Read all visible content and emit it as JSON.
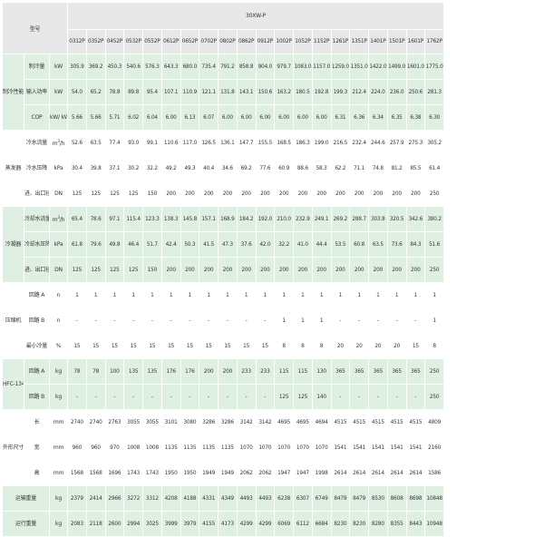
{
  "header": {
    "type_label": "型号",
    "series": "30XW-P",
    "models": [
      "0312P",
      "0352P",
      "0452P",
      "0532P",
      "0552P",
      "0612P",
      "0652P",
      "0702P",
      "0802P",
      "0862P",
      "0912P",
      "1002P",
      "1052P",
      "1152P",
      "1261P",
      "1351P",
      "1401P",
      "1501P",
      "1601P",
      "1762P"
    ]
  },
  "groups": [
    {
      "label": "制冷性能",
      "color": "green",
      "rows": [
        {
          "name": "制冷量",
          "unit": "kW",
          "values": [
            "305.9",
            "369.2",
            "450.3",
            "540.6",
            "576.3",
            "643.3",
            "680.0",
            "735.4",
            "791.2",
            "858.8",
            "904.0",
            "979.7",
            "1083.0",
            "1157.0",
            "1259.0",
            "1351.0",
            "1422.0",
            "1499.0",
            "1601.0",
            "1775.0"
          ]
        },
        {
          "name": "输入功率",
          "unit": "kW",
          "values": [
            "54.0",
            "65.2",
            "78.8",
            "89.8",
            "95.4",
            "107.1",
            "110.9",
            "121.1",
            "131.8",
            "143.1",
            "150.6",
            "163.2",
            "180.5",
            "192.8",
            "199.3",
            "212.4",
            "224.0",
            "236.0",
            "250.6",
            "281.3"
          ]
        },
        {
          "name": "COP",
          "unit": "kW/ kW",
          "values": [
            "5.66",
            "5.66",
            "5.71",
            "6.02",
            "6.04",
            "6.00",
            "6.13",
            "6.07",
            "6.00",
            "6.00",
            "6.00",
            "6.00",
            "6.00",
            "6.00",
            "6.31",
            "6.36",
            "6.34",
            "6.35",
            "6.38",
            "6.30"
          ]
        }
      ]
    },
    {
      "label": "蒸发器",
      "color": "white",
      "rows": [
        {
          "name": "冷水流量",
          "unit": "m³/h",
          "values": [
            "52.6",
            "63.5",
            "77.4",
            "93.0",
            "99.1",
            "110.6",
            "117.0",
            "126.5",
            "136.1",
            "147.7",
            "155.5",
            "168.5",
            "186.3",
            "199.0",
            "216.5",
            "232.4",
            "244.6",
            "257.9",
            "275.3",
            "305.2"
          ]
        },
        {
          "name": "冷水压降",
          "unit": "kPa",
          "values": [
            "30.4",
            "39.8",
            "37.1",
            "30.2",
            "32.2",
            "49.2",
            "49.3",
            "40.4",
            "34.6",
            "69.2",
            "77.6",
            "60.9",
            "88.6",
            "58.3",
            "62.2",
            "71.1",
            "74.8",
            "81.2",
            "85.5",
            "61.4"
          ]
        },
        {
          "name": "进、出口径",
          "unit": "DN",
          "values": [
            "125",
            "125",
            "125",
            "125",
            "150",
            "200",
            "200",
            "200",
            "200",
            "200",
            "200",
            "200",
            "200",
            "200",
            "200",
            "200",
            "200",
            "200",
            "200",
            "250"
          ]
        }
      ]
    },
    {
      "label": "冷凝器",
      "color": "green",
      "rows": [
        {
          "name": "冷却水流量",
          "unit": "m³/h",
          "values": [
            "65.4",
            "78.6",
            "97.1",
            "115.4",
            "123.3",
            "138.3",
            "145.8",
            "157.1",
            "168.9",
            "184.2",
            "192.0",
            "210.0",
            "232.9",
            "249.1",
            "269.2",
            "288.7",
            "303.8",
            "320.5",
            "342.6",
            "380.2"
          ]
        },
        {
          "name": "冷却水压降",
          "unit": "kPa",
          "values": [
            "61.8",
            "79.6",
            "49.8",
            "46.4",
            "51.7",
            "42.4",
            "50.3",
            "41.5",
            "47.3",
            "37.6",
            "42.0",
            "32.2",
            "41.0",
            "44.4",
            "53.5",
            "60.8",
            "63.5",
            "73.6",
            "84.3",
            "51.6"
          ]
        },
        {
          "name": "进、出口径",
          "unit": "DN",
          "values": [
            "125",
            "125",
            "125",
            "125",
            "150",
            "200",
            "200",
            "200",
            "200",
            "200",
            "200",
            "200",
            "200",
            "200",
            "200",
            "200",
            "200",
            "200",
            "200",
            "250"
          ]
        }
      ]
    },
    {
      "label": "压缩机",
      "color": "white",
      "rows": [
        {
          "name": "回路 A",
          "unit": "n",
          "values": [
            "1",
            "1",
            "1",
            "1",
            "1",
            "1",
            "1",
            "1",
            "1",
            "1",
            "1",
            "1",
            "1",
            "1",
            "1",
            "1",
            "1",
            "1",
            "1",
            "1"
          ]
        },
        {
          "name": "回路 B",
          "unit": "n",
          "values": [
            "-",
            "-",
            "-",
            "-",
            "-",
            "-",
            "-",
            "-",
            "-",
            "-",
            "-",
            "1",
            "1",
            "1",
            "-",
            "-",
            "-",
            "-",
            "-",
            "1"
          ]
        },
        {
          "name": "最小冷量",
          "unit": "%",
          "values": [
            "15",
            "15",
            "15",
            "15",
            "15",
            "15",
            "15",
            "15",
            "15",
            "15",
            "15",
            "8",
            "8",
            "8",
            "20",
            "20",
            "20",
            "20",
            "15",
            "8"
          ]
        }
      ]
    },
    {
      "label": "HFC-134a 充注量",
      "color": "green",
      "rows": [
        {
          "name": "回路 A",
          "unit": "kg",
          "values": [
            "78",
            "78",
            "100",
            "135",
            "135",
            "176",
            "176",
            "200",
            "200",
            "233",
            "233",
            "115",
            "115",
            "130",
            "365",
            "365",
            "365",
            "365",
            "365",
            "250"
          ]
        },
        {
          "name": "回路 B",
          "unit": "kg",
          "values": [
            "-",
            "-",
            "-",
            "-",
            "-",
            "-",
            "-",
            "-",
            "-",
            "-",
            "-",
            "125",
            "125",
            "140",
            "-",
            "-",
            "-",
            "-",
            "-",
            "250"
          ]
        }
      ]
    },
    {
      "label": "外形尺寸",
      "color": "white",
      "rows": [
        {
          "name": "长",
          "unit": "mm",
          "values": [
            "2740",
            "2740",
            "2763",
            "3055",
            "3055",
            "3101",
            "3080",
            "3286",
            "3286",
            "3142",
            "3142",
            "4695",
            "4695",
            "4694",
            "4515",
            "4515",
            "4515",
            "4515",
            "4515",
            "4809"
          ]
        },
        {
          "name": "宽",
          "unit": "mm",
          "values": [
            "960",
            "960",
            "970",
            "1008",
            "1008",
            "1135",
            "1135",
            "1135",
            "1135",
            "1070",
            "1070",
            "1070",
            "1070",
            "1070",
            "1541",
            "1541",
            "1541",
            "1541",
            "1541",
            "2160"
          ]
        },
        {
          "name": "高",
          "unit": "mm",
          "values": [
            "1568",
            "1568",
            "1696",
            "1743",
            "1743",
            "1950",
            "1950",
            "1949",
            "1949",
            "2062",
            "2062",
            "1947",
            "1947",
            "1998",
            "2614",
            "2614",
            "2614",
            "2614",
            "2614",
            "1586"
          ]
        }
      ]
    },
    {
      "label": "运输重量",
      "color": "green",
      "single": true,
      "rows": [
        {
          "name": "",
          "unit": "kg",
          "values": [
            "2379",
            "2414",
            "2966",
            "3272",
            "3312",
            "4208",
            "4188",
            "4331",
            "4349",
            "4493",
            "4493",
            "6238",
            "6307",
            "6749",
            "8479",
            "8479",
            "8530",
            "8608",
            "8698",
            "10848"
          ]
        }
      ]
    },
    {
      "label": "运行重量",
      "color": "green",
      "single": true,
      "rows": [
        {
          "name": "",
          "unit": "kg",
          "values": [
            "2083",
            "2118",
            "2600",
            "2994",
            "3025",
            "3999",
            "3979",
            "4155",
            "4173",
            "4299",
            "4299",
            "6069",
            "6112",
            "6684",
            "8230",
            "8230",
            "8280",
            "8355",
            "8443",
            "10948"
          ]
        }
      ]
    }
  ]
}
